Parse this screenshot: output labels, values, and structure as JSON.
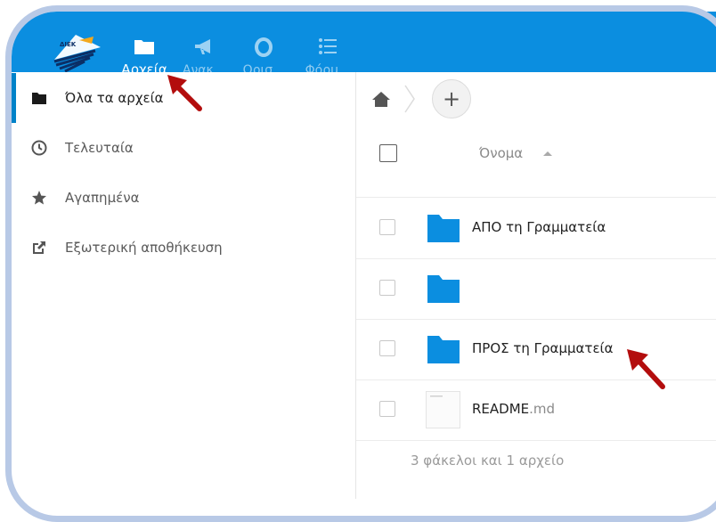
{
  "app": {
    "nav": [
      {
        "label": "Αρχεία",
        "icon": "folder-icon",
        "active": true
      },
      {
        "label": "Ανακ...",
        "icon": "announcement-icon",
        "active": false
      },
      {
        "label": "Ορισ...",
        "icon": "circle-o-icon",
        "active": false
      },
      {
        "label": "Φόρμ...",
        "icon": "forms-list-icon",
        "active": false
      }
    ],
    "logo_text": "ΔΙΕΚ"
  },
  "sidebar": {
    "items": [
      {
        "label": "Όλα τα αρχεία",
        "icon": "folder-icon",
        "active": true
      },
      {
        "label": "Τελευταία",
        "icon": "clock-icon",
        "active": false
      },
      {
        "label": "Αγαπημένα",
        "icon": "star-icon",
        "active": false
      },
      {
        "label": "Εξωτερική αποθήκευση",
        "icon": "external-link-icon",
        "active": false
      }
    ]
  },
  "files": {
    "column_name": "Όνομα",
    "rows": [
      {
        "name": "ΑΠΟ τη Γραμματεία",
        "ext": "",
        "type": "folder"
      },
      {
        "name": "",
        "ext": "",
        "type": "folder"
      },
      {
        "name": "ΠΡΟΣ τη Γραμματεία",
        "ext": "",
        "type": "folder"
      },
      {
        "name": "README",
        "ext": ".md",
        "type": "file"
      }
    ],
    "summary": "3 φάκελοι και 1 αρχείο"
  },
  "colors": {
    "header": "#0b8ee0",
    "folder": "#0b8ee0",
    "arrow": "#b30d0d",
    "frame": "#b8c9e6"
  }
}
